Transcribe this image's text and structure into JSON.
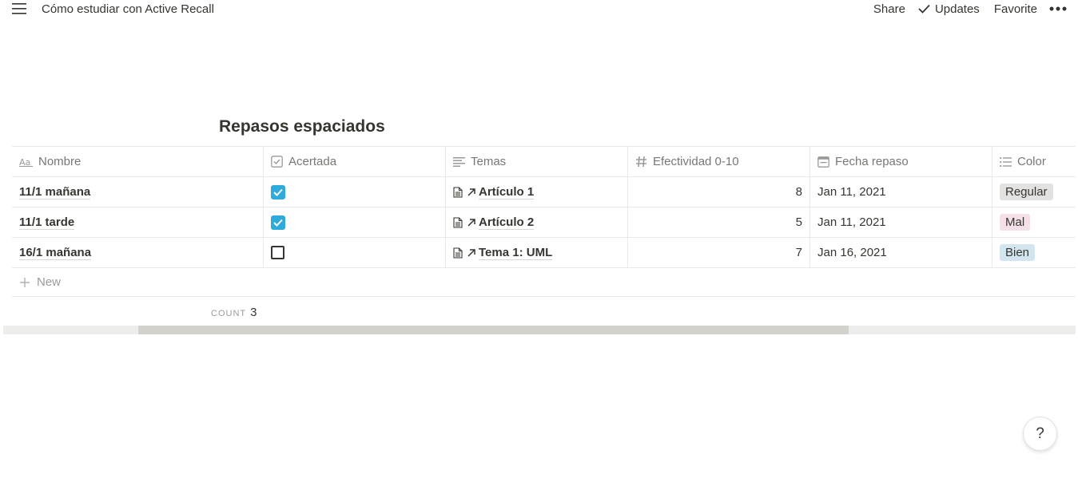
{
  "topbar": {
    "breadcrumb": "Cómo estudiar con Active Recall",
    "share": "Share",
    "updates": "Updates",
    "favorite": "Favorite",
    "more_icon": "more-horizontal-icon"
  },
  "database": {
    "title": "Repasos espaciados",
    "columns": [
      {
        "label": "Nombre",
        "icon": "text-aa-icon"
      },
      {
        "label": "Acertada",
        "icon": "checkbox-icon"
      },
      {
        "label": "Temas",
        "icon": "lines-icon"
      },
      {
        "label": "Efectividad 0-10",
        "icon": "hash-icon"
      },
      {
        "label": "Fecha repaso",
        "icon": "calendar-icon"
      },
      {
        "label": "Color",
        "icon": "list-icon"
      }
    ],
    "rows": [
      {
        "nombre": "11/1 mañana",
        "acertada": true,
        "tema": "Artículo 1",
        "efectividad": "8",
        "fecha": "Jan 11, 2021",
        "color": "Regular",
        "color_bg": "#e3e2e0"
      },
      {
        "nombre": "11/1 tarde",
        "acertada": true,
        "tema": "Artículo 2",
        "efectividad": "5",
        "fecha": "Jan 11, 2021",
        "color": "Mal",
        "color_bg": "#f5e0e9"
      },
      {
        "nombre": "16/1 mañana",
        "acertada": false,
        "tema": "Tema 1: UML",
        "efectividad": "7",
        "fecha": "Jan 16, 2021",
        "color": "Bien",
        "color_bg": "#d3e5ef"
      }
    ],
    "new_label": "New",
    "count_label": "COUNT",
    "count_value": "3"
  },
  "help": {
    "label": "?"
  },
  "colors": {
    "checkbox_checked": "#2eaadc",
    "text": "#37352f",
    "muted": "#787774"
  }
}
